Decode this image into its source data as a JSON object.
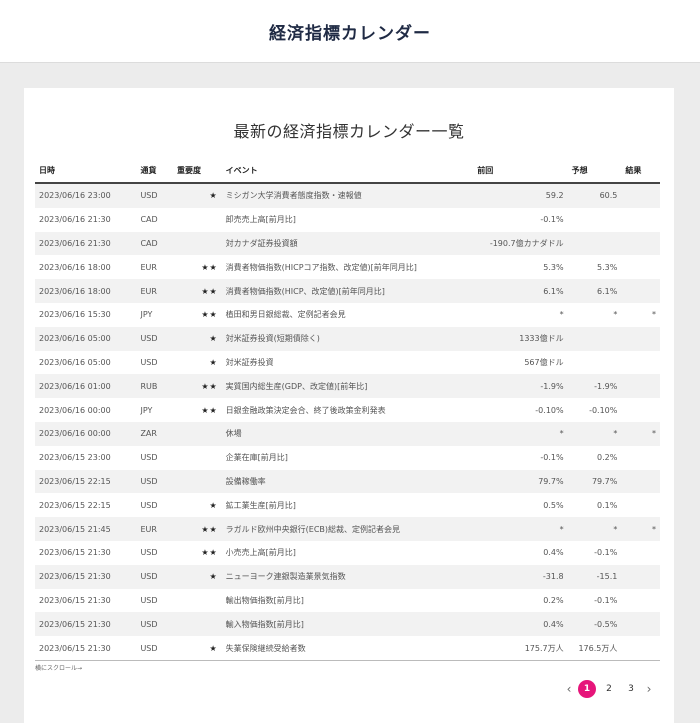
{
  "site": {
    "title": "経済指標カレンダー"
  },
  "card": {
    "title": "最新の経済指標カレンダー一覧"
  },
  "table": {
    "headers": [
      "日時",
      "通貨",
      "重要度",
      "イベント",
      "前回",
      "予想",
      "結果"
    ],
    "rows": [
      [
        "2023/06/16 23:00",
        "USD",
        "★",
        "ミシガン大学消費者態度指数・速報値",
        "59.2",
        "60.5",
        ""
      ],
      [
        "2023/06/16 21:30",
        "CAD",
        "",
        "卸売売上高[前月比]",
        "-0.1%",
        "",
        ""
      ],
      [
        "2023/06/16 21:30",
        "CAD",
        "",
        "対カナダ証券投資額",
        "-190.7億カナダドル",
        "",
        ""
      ],
      [
        "2023/06/16 18:00",
        "EUR",
        "★★",
        "消費者物価指数(HICPコア指数、改定値)[前年同月比]",
        "5.3%",
        "5.3%",
        ""
      ],
      [
        "2023/06/16 18:00",
        "EUR",
        "★★",
        "消費者物価指数(HICP、改定値)[前年同月比]",
        "6.1%",
        "6.1%",
        ""
      ],
      [
        "2023/06/16 15:30",
        "JPY",
        "★★",
        "植田和男日銀総裁、定例記者会見",
        "*",
        "*",
        "*"
      ],
      [
        "2023/06/16 05:00",
        "USD",
        "★",
        "対米証券投資(短期債除く)",
        "1333億ドル",
        "",
        ""
      ],
      [
        "2023/06/16 05:00",
        "USD",
        "★",
        "対米証券投資",
        "567億ドル",
        "",
        ""
      ],
      [
        "2023/06/16 01:00",
        "RUB",
        "★★",
        "実質国内総生産(GDP、改定値)[前年比]",
        "-1.9%",
        "-1.9%",
        ""
      ],
      [
        "2023/06/16 00:00",
        "JPY",
        "★★",
        "日銀金融政策決定会合、終了後政策金利発表",
        "-0.10%",
        "-0.10%",
        ""
      ],
      [
        "2023/06/16 00:00",
        "ZAR",
        "",
        "休場",
        "*",
        "*",
        "*"
      ],
      [
        "2023/06/15 23:00",
        "USD",
        "",
        "企業在庫[前月比]",
        "-0.1%",
        "0.2%",
        ""
      ],
      [
        "2023/06/15 22:15",
        "USD",
        "",
        "設備稼働率",
        "79.7%",
        "79.7%",
        ""
      ],
      [
        "2023/06/15 22:15",
        "USD",
        "★",
        "鉱工業生産[前月比]",
        "0.5%",
        "0.1%",
        ""
      ],
      [
        "2023/06/15 21:45",
        "EUR",
        "★★",
        "ラガルド欧州中央銀行(ECB)総裁、定例記者会見",
        "*",
        "*",
        "*"
      ],
      [
        "2023/06/15 21:30",
        "USD",
        "★★",
        "小売売上高[前月比]",
        "0.4%",
        "-0.1%",
        ""
      ],
      [
        "2023/06/15 21:30",
        "USD",
        "★",
        "ニューヨーク連銀製造業景気指数",
        "-31.8",
        "-15.1",
        ""
      ],
      [
        "2023/06/15 21:30",
        "USD",
        "",
        "輸出物価指数[前月比]",
        "0.2%",
        "-0.1%",
        ""
      ],
      [
        "2023/06/15 21:30",
        "USD",
        "",
        "輸入物価指数[前月比]",
        "0.4%",
        "-0.5%",
        ""
      ],
      [
        "2023/06/15 21:30",
        "USD",
        "★",
        "失業保険継続受給者数",
        "175.7万人",
        "176.5万人",
        ""
      ]
    ]
  },
  "scroll_hint": "横にスクロール→",
  "pagination": {
    "prev_icon": "chevron-left-icon",
    "next_icon": "chevron-right-icon",
    "pages": [
      "1",
      "2",
      "3"
    ],
    "current": "1",
    "active_color": "#e6157a"
  }
}
